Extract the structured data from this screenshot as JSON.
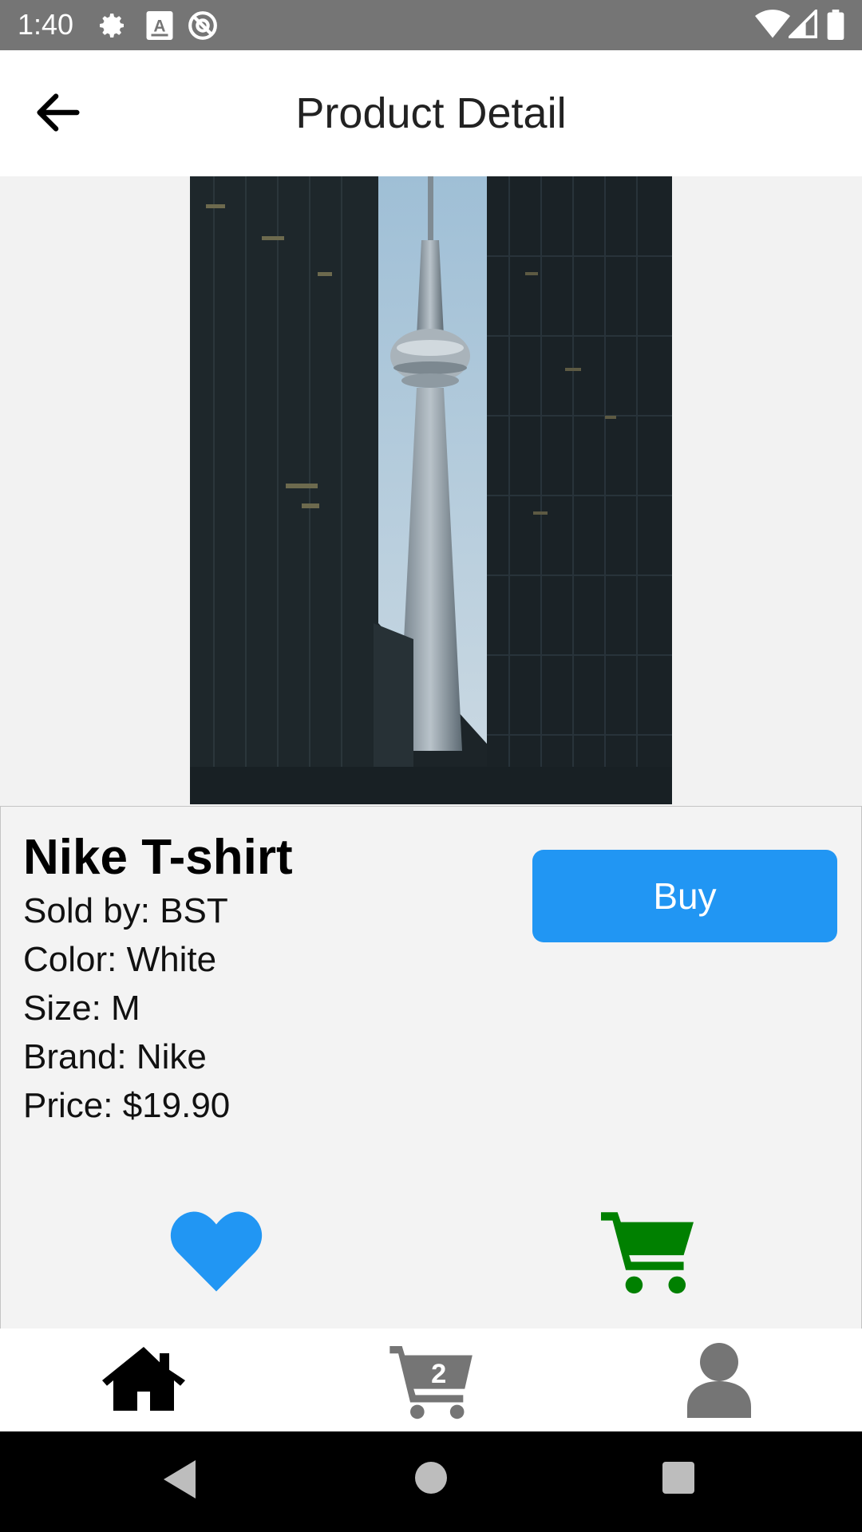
{
  "status_bar": {
    "time": "1:40",
    "icons": [
      "settings-icon",
      "a-icon",
      "at-icon",
      "wifi-icon",
      "signal-icon",
      "battery-icon"
    ]
  },
  "app_bar": {
    "title": "Product Detail",
    "back_icon": "arrow-left-icon"
  },
  "product": {
    "name": "Nike T-shirt",
    "sold_by": "Sold by: BST",
    "color": "Color: White",
    "size": "Size: M",
    "brand": "Brand: Nike",
    "price": "Price: $19.90",
    "buy_label": "Buy"
  },
  "actions": {
    "favorite_icon": "heart-icon",
    "add_to_cart_icon": "cart-icon"
  },
  "bottom_nav": {
    "items": [
      {
        "icon": "home-icon"
      },
      {
        "icon": "cart-icon",
        "badge": "2"
      },
      {
        "icon": "user-icon"
      }
    ]
  },
  "colors": {
    "accent": "#2196f3",
    "cart_green": "#008000",
    "status_bar": "#757575"
  }
}
